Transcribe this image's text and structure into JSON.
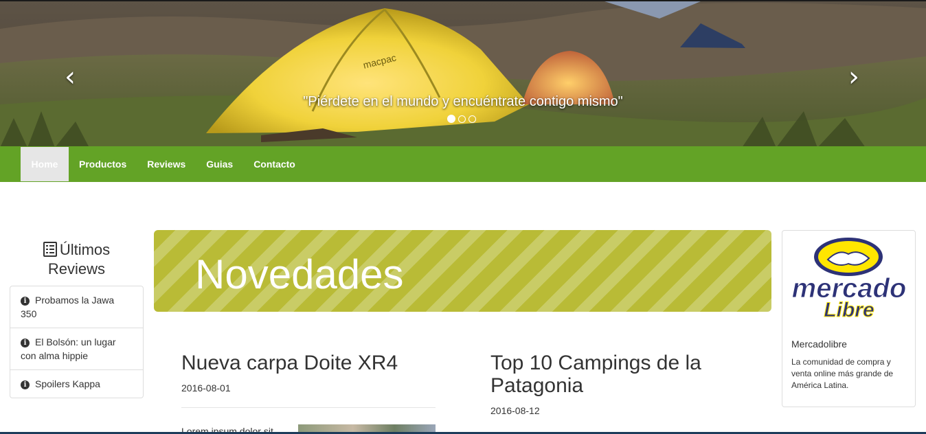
{
  "carousel": {
    "caption": "\"Piérdete en el mundo y encuéntrate contigo mismo\"",
    "prev_icon": "chevron-left-icon",
    "next_icon": "chevron-right-icon",
    "indicator_count": 3,
    "active_indicator": 0,
    "tent_label": "macpac"
  },
  "navbar": {
    "color": "#63a326",
    "items": [
      {
        "label": "Home",
        "active": true
      },
      {
        "label": "Productos"
      },
      {
        "label": "Reviews"
      },
      {
        "label": "Guias"
      },
      {
        "label": "Contacto"
      }
    ]
  },
  "sidebar": {
    "icon": "list-alt-icon",
    "title_line1": "Últimos",
    "title_line2": "Reviews",
    "reviews": [
      {
        "icon": "info-sign-icon",
        "title": "Probamos la Jawa 350"
      },
      {
        "icon": "info-sign-icon",
        "title": "El Bolsón: un lugar con alma hippie"
      },
      {
        "icon": "info-sign-icon",
        "title": "Spoilers Kappa"
      }
    ]
  },
  "jumbotron": {
    "heading": "Novedades",
    "colors": [
      "#b9bb36",
      "#c9cc66"
    ]
  },
  "posts": [
    {
      "title": "Nueva carpa Doite XR4",
      "date": "2016-08-01",
      "excerpt": "Lorem ipsum dolor sit"
    },
    {
      "title": "Top 10 Campings de la Patagonia",
      "date": "2016-08-12"
    }
  ],
  "ad": {
    "logo_text_1": "mercado",
    "logo_text_2": "Libre",
    "title": "Mercadolibre",
    "text": "La comunidad de compra y venta online más grande de América Latina."
  }
}
